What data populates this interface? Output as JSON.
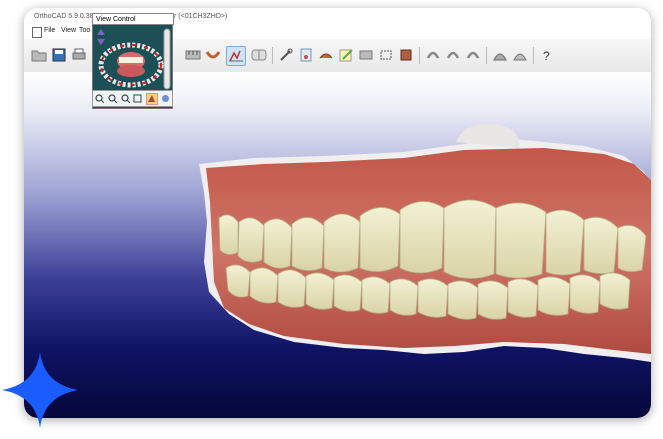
{
  "window": {
    "title": "OrthoCAD 5.9.0.38",
    "title_suffix": "r (<01CH3ZHD>)"
  },
  "menu": {
    "items": [
      "File",
      "View",
      "Too"
    ]
  },
  "view_control": {
    "label": "View Control"
  },
  "toolbar": {
    "icons": [
      "open-folder-icon",
      "save-icon",
      "print-icon",
      "scan-icon",
      "measure-icon",
      "arch-icon",
      "bite-icon",
      "split-view-icon",
      "tooth-select-icon",
      "tooth-view-icon",
      "wrench-icon",
      "model-icon",
      "ipr-icon",
      "notes-icon",
      "grid-icon",
      "crop-icon",
      "paint-icon",
      "rotate-left-icon",
      "rotate-up-icon",
      "rotate-right-icon",
      "jaw-upper-icon",
      "jaw-lower-icon",
      "help-icon"
    ]
  },
  "colors": {
    "accent_active": "#7fa9d6",
    "sparkle": "#1a5cff"
  }
}
